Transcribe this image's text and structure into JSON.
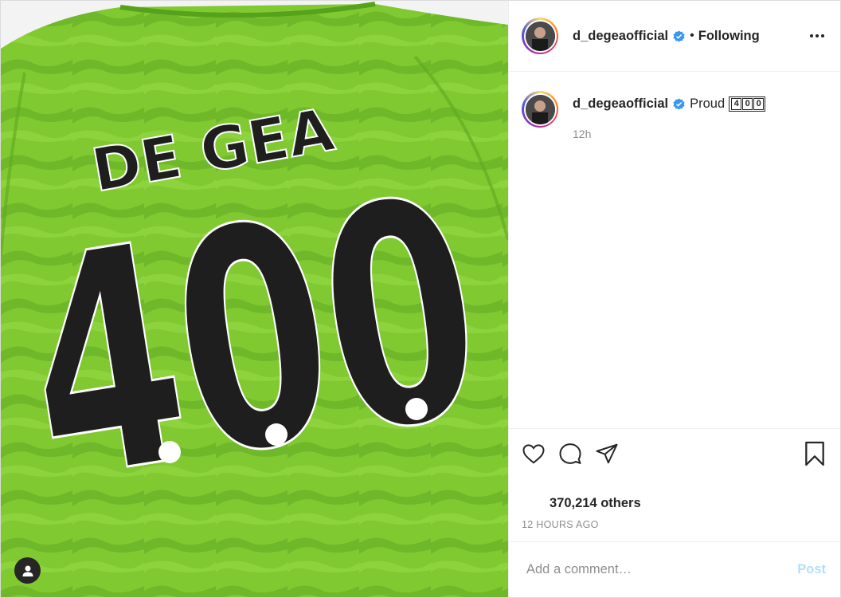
{
  "post": {
    "author": {
      "username": "d_degeaofficial",
      "verified": true,
      "follow_state": "Following",
      "separator": "•"
    },
    "media": {
      "description_icons": [
        "user-tag-icon"
      ],
      "jersey_name": "DE GEA",
      "jersey_number": "400",
      "colors": {
        "jersey": "#7cc62f",
        "jersey_dark": "#5ea822",
        "print": "#1e1e1e"
      }
    },
    "caption": {
      "username": "d_degeaofficial",
      "text": "Proud",
      "boxed_digits": [
        "4",
        "0",
        "0"
      ],
      "time": "12h"
    },
    "actions": {
      "icons": [
        "heart-icon",
        "comment-icon",
        "share-icon",
        "bookmark-icon"
      ]
    },
    "likes_text": "370,214 others",
    "timestamp": "12 HOURS AGO",
    "comment": {
      "placeholder": "Add a comment…",
      "post_label": "Post"
    },
    "colors": {
      "link_disabled": "#b2dffc",
      "verified": "#3897f0",
      "text": "#262626",
      "muted": "#8e8e8e"
    }
  }
}
